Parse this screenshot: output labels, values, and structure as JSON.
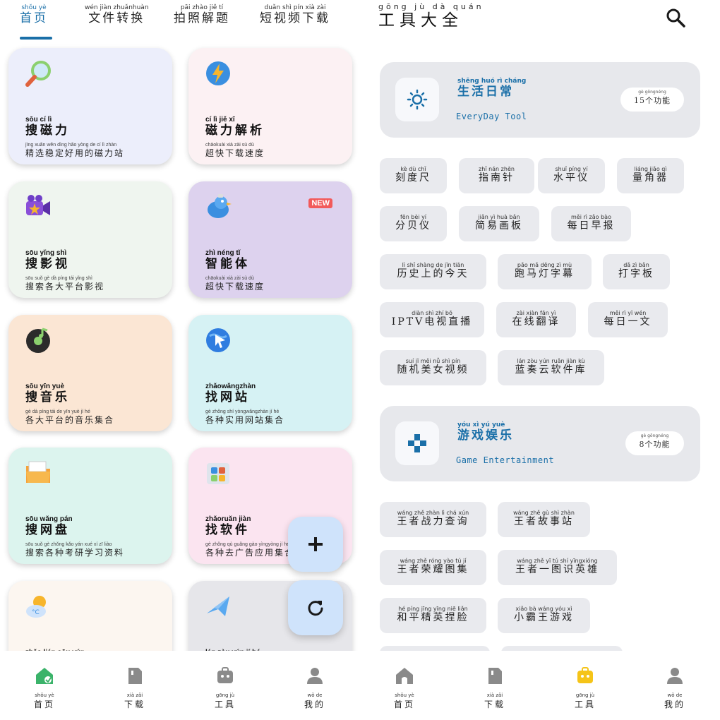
{
  "left": {
    "top_tabs": [
      {
        "py": "shǒu yè",
        "label": "首页",
        "active": true
      },
      {
        "py": "wén jiàn zhuǎnhuàn",
        "label": "文件转换"
      },
      {
        "py": "pāi zhào jiě tí",
        "label": "拍照解题"
      },
      {
        "py": "duǎn shì pín xià zài",
        "label": "短视频下载"
      }
    ],
    "cards": [
      {
        "title_py": "sōu cí lì",
        "title": "搜磁力",
        "sub_py": "jīng xuǎn wěn dìng hǎo yòng de cí lì zhàn",
        "sub": "精选稳定好用的磁力站",
        "bg": "#eceefb",
        "icon": "magnifier-icon"
      },
      {
        "title_py": "cí lì jiě xī",
        "title": "磁力解析",
        "sub_py": "chāokuài xià zài sù dù",
        "sub": "超快下载速度",
        "bg": "#fcf1f3",
        "icon": "lightning-chat-icon"
      },
      {
        "title_py": "sōu yǐng shì",
        "title": "搜影视",
        "sub_py": "sōu suǒ gè dà píng tái yǐng shì",
        "sub": "搜索各大平台影视",
        "bg": "#eff5ef",
        "icon": "video-camera-icon"
      },
      {
        "title_py": "zhì néng tǐ",
        "title": "智能体",
        "sub_py": "chāokuài xià zài sù dù",
        "sub": "超快下载速度",
        "bg": "#ddd2ee",
        "icon": "bird-icon",
        "badge": "NEW"
      },
      {
        "title_py": "sōu yīn yuè",
        "title": "搜音乐",
        "sub_py": "gè dà píng tái de yīn yuè jí hé",
        "sub": "各大平台的音乐集合",
        "bg": "#fbe6d4",
        "icon": "music-disc-icon"
      },
      {
        "title_py": "zhǎowǎngzhàn",
        "title": "找网站",
        "sub_py": "gè zhǒng shí yòngwǎngzhàn jí hé",
        "sub": "各种实用网站集合",
        "bg": "#d6f2f4",
        "icon": "globe-cursor-icon"
      },
      {
        "title_py": "sōu wǎng pán",
        "title": "搜网盘",
        "sub_py": "sōu suǒ gè zhǒng kǎo yán xué xí zī liào",
        "sub": "搜索各种考研学习资料",
        "bg": "#dcf4ee",
        "icon": "folder-icon"
      },
      {
        "title_py": "zhǎoruǎn jiàn",
        "title": "找软件",
        "sub_py": "gè zhǒng qù guǎng gào yìngyòng jí hé",
        "sub": "各种去广告应用集合",
        "bg": "#fbe4f0",
        "icon": "app-box-icon"
      },
      {
        "title_py": "zhǎo lián sōu yún",
        "title": "",
        "sub_py": "",
        "sub": "",
        "bg": "#fcf6f0",
        "icon": "weather-icon"
      },
      {
        "title_py": "lán zòu yún jí hé",
        "title": "",
        "sub_py": "",
        "sub": "",
        "bg": "#e6e6ea",
        "icon": "plane-icon"
      }
    ],
    "fabs": {
      "add": "+",
      "refresh": "refresh"
    },
    "bottom_nav": [
      {
        "py": "shǒu yè",
        "label": "首页",
        "active": true
      },
      {
        "py": "xià zǎi",
        "label": "下载"
      },
      {
        "py": "gōng jù",
        "label": "工具"
      },
      {
        "py": "wǒ de",
        "label": "我的"
      }
    ]
  },
  "right": {
    "title_py": "gōng jù dà quán",
    "title": "工具大全",
    "sections": [
      {
        "title_py": "shēng huó rì cháng",
        "title": "生活日常",
        "en": "EveryDay Tool",
        "count_py": "gè gōngnéng",
        "count": "15个功能",
        "icon": "sun-icon",
        "items": [
          {
            "py": "kè dù chǐ",
            "label": "刻度尺"
          },
          {
            "py": "zhǐ nán zhēn",
            "label": "指南针"
          },
          {
            "py": "shuǐ píng yí",
            "label": "水平仪"
          },
          {
            "py": "liáng jiǎo qì",
            "label": "量角器"
          },
          {
            "py": "fēn bèi yí",
            "label": "分贝仪"
          },
          {
            "py": "jiǎn yì huà bǎn",
            "label": "简易画板"
          },
          {
            "py": "měi rì zǎo bào",
            "label": "每日早报"
          },
          {
            "py": "lì shǐ shàng de jīn tiān",
            "label": "历史上的今天"
          },
          {
            "py": "pǎo mǎ dēng zì mù",
            "label": "跑马灯字幕"
          },
          {
            "py": "dǎ zì bǎn",
            "label": "打字板"
          },
          {
            "py": "diàn shì zhí bō",
            "label": "IPTV电视直播"
          },
          {
            "py": "zài xiàn fān yì",
            "label": "在线翻译"
          },
          {
            "py": "měi rì yī wén",
            "label": "每日一文"
          },
          {
            "py": "suí jī měi nǚ shì pín",
            "label": "随机美女视频"
          },
          {
            "py": "lán zòu yún ruǎn jiàn kù",
            "label": "蓝奏云软件库"
          }
        ]
      },
      {
        "title_py": "yóu xì yú yuè",
        "title": "游戏娱乐",
        "en": "Game Entertainment",
        "count_py": "gè gōngnéng",
        "count": "8个功能",
        "icon": "gamepad-icon",
        "items": [
          {
            "py": "wáng zhě zhàn lì chá xún",
            "label": "王者战力查询"
          },
          {
            "py": "wáng zhě gù shì zhàn",
            "label": "王者故事站"
          },
          {
            "py": "wáng zhě róng yào tú jí",
            "label": "王者荣耀图集"
          },
          {
            "py": "wáng zhě yī tú shí yīngxióng",
            "label": "王者一图识英雄"
          },
          {
            "py": "hé píng jīng yīng niē liǎn",
            "label": "和平精英捏脸"
          },
          {
            "py": "xiǎo bà wáng yóu xì",
            "label": "小霸王游戏"
          }
        ]
      }
    ],
    "bottom_nav": [
      {
        "py": "shǒu yè",
        "label": "首页"
      },
      {
        "py": "xià zǎi",
        "label": "下载"
      },
      {
        "py": "gōng jù",
        "label": "工具",
        "active": true
      },
      {
        "py": "wǒ de",
        "label": "我的"
      }
    ]
  },
  "colors": {
    "accent": "#1a6fa8",
    "nav_active_left": "#3bb36a",
    "nav_active_right": "#f5c418",
    "nav_inactive": "#8a8a8a"
  }
}
